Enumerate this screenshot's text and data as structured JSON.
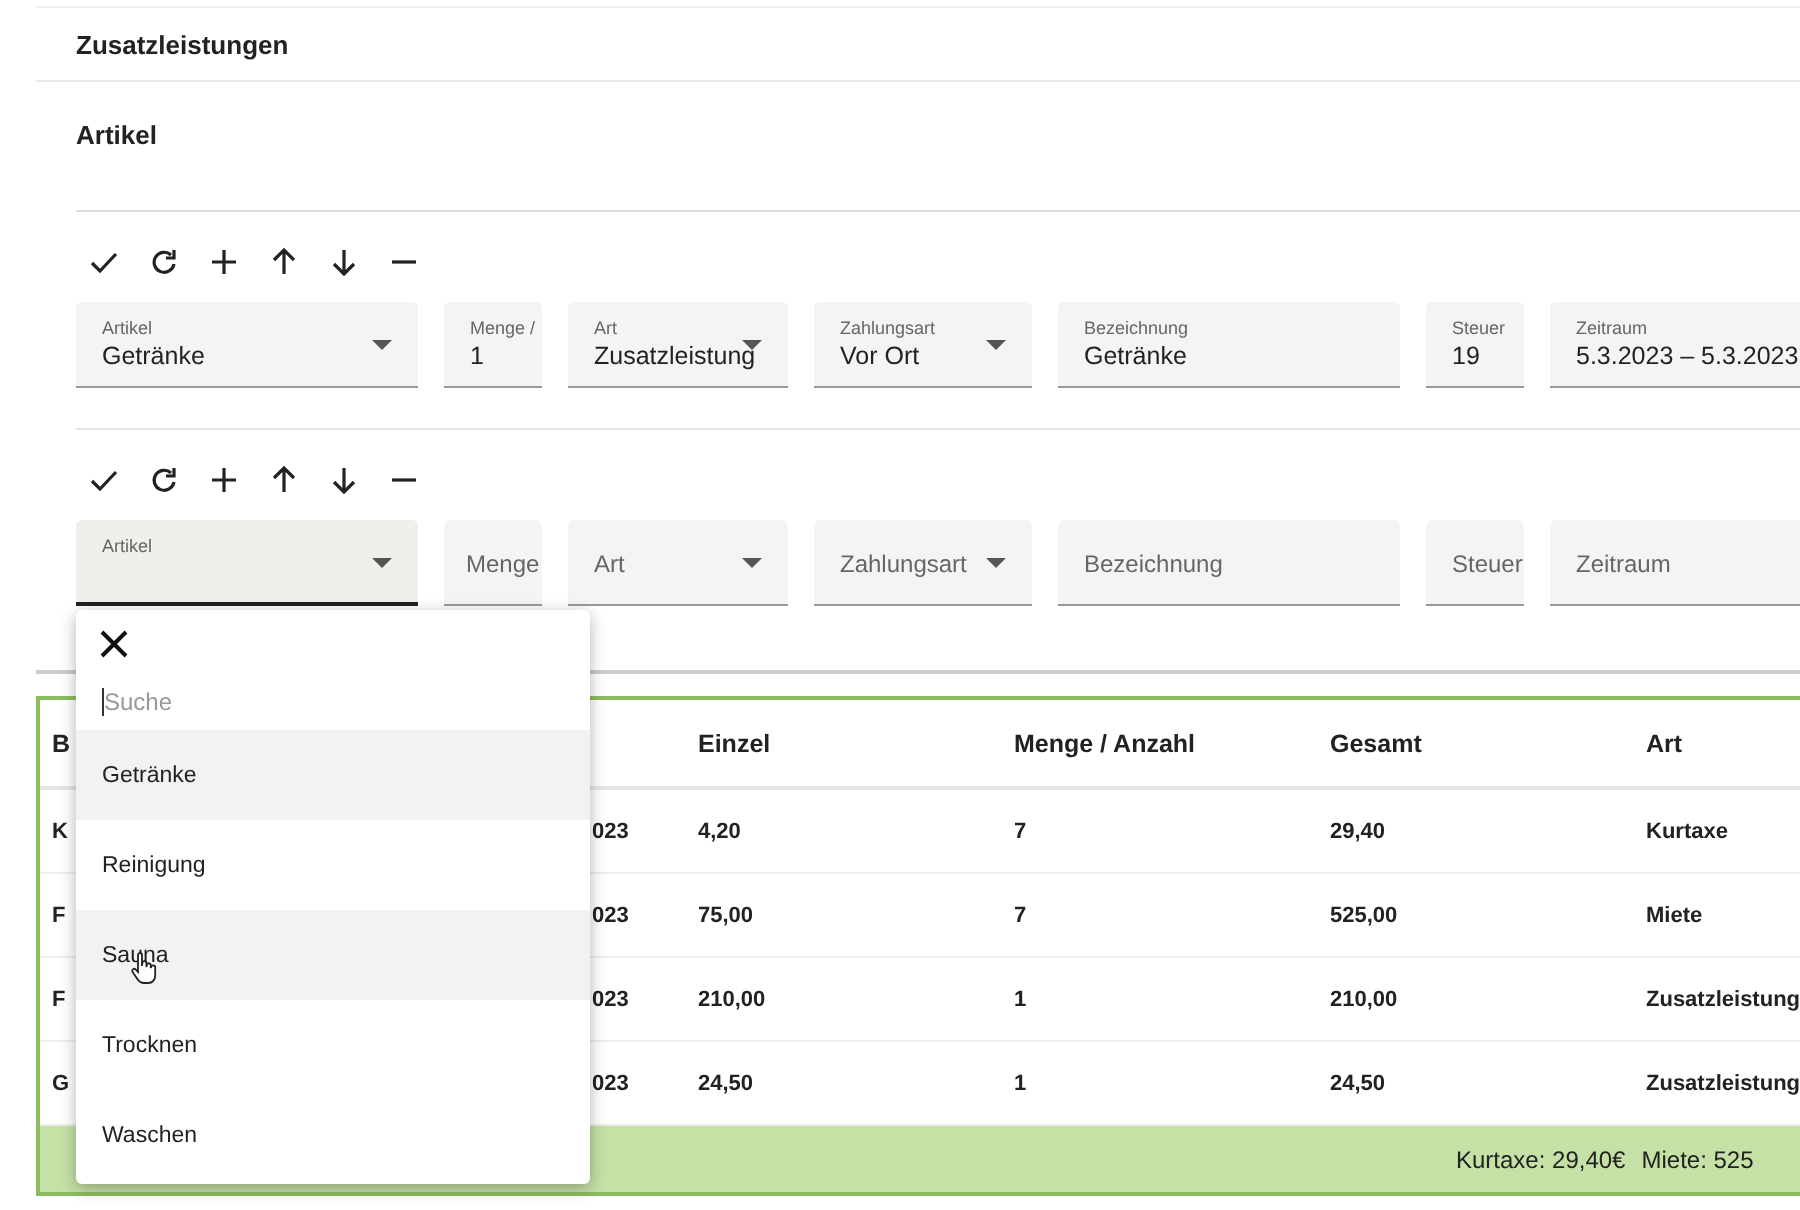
{
  "section_title": "Zusatzleistungen",
  "subsection_title": "Artikel",
  "editors": [
    {
      "fields": [
        {
          "kind": "select",
          "label": "Artikel",
          "value": "Getränke",
          "focused": false
        },
        {
          "kind": "text",
          "label": "Menge /",
          "value": "1",
          "focused": false
        },
        {
          "kind": "select",
          "label": "Art",
          "value": "Zusatzleistung",
          "focused": false
        },
        {
          "kind": "select",
          "label": "Zahlungsart",
          "value": "Vor Ort",
          "focused": false
        },
        {
          "kind": "text",
          "label": "Bezeichnung",
          "value": "Getränke",
          "focused": false
        },
        {
          "kind": "text",
          "label": "Steuer",
          "value": "19",
          "focused": false
        },
        {
          "kind": "text",
          "label": "Zeitraum",
          "value": "5.3.2023 – 5.3.2023",
          "focused": false
        }
      ]
    },
    {
      "fields": [
        {
          "kind": "select",
          "label": "Artikel",
          "focused": true
        },
        {
          "kind": "text",
          "placeholder": "Menge",
          "focused": false
        },
        {
          "kind": "select",
          "placeholder": "Art",
          "focused": false
        },
        {
          "kind": "select",
          "placeholder": "Zahlungsart",
          "focused": false
        },
        {
          "kind": "text",
          "placeholder": "Bezeichnung",
          "focused": false
        },
        {
          "kind": "text",
          "placeholder": "Steuer",
          "focused": false
        },
        {
          "kind": "text",
          "placeholder": "Zeitraum",
          "focused": false
        }
      ]
    }
  ],
  "dropdown": {
    "search_placeholder": "Suche",
    "options": [
      {
        "label": "Getränke",
        "highlighted": true,
        "pointer": false
      },
      {
        "label": "Reinigung",
        "highlighted": false,
        "pointer": false
      },
      {
        "label": "Sauna",
        "highlighted": true,
        "pointer": true
      },
      {
        "label": "Trocknen",
        "highlighted": false,
        "pointer": false
      },
      {
        "label": "Waschen",
        "highlighted": false,
        "pointer": false
      }
    ]
  },
  "table": {
    "columns": [
      "B",
      null,
      "Einzel",
      "Menge / Anzahl",
      "Gesamt",
      "Art"
    ],
    "rows": [
      [
        "K",
        "023",
        "4,20",
        "7",
        "29,40",
        "Kurtaxe"
      ],
      [
        "F",
        "023",
        "75,00",
        "7",
        "525,00",
        "Miete"
      ],
      [
        "F",
        "023",
        "210,00",
        "1",
        "210,00",
        "Zusatzleistung"
      ],
      [
        "G",
        "023",
        "24,50",
        "1",
        "24,50",
        "Zusatzleistung"
      ]
    ],
    "footer": [
      "Kurtaxe: 29,40€",
      "Miete: 525"
    ]
  }
}
